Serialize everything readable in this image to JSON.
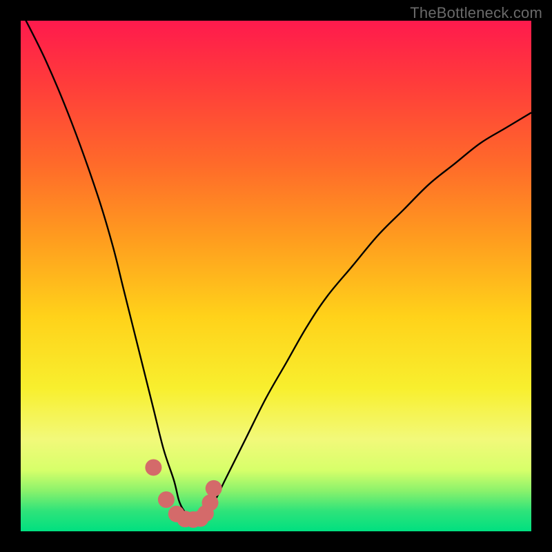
{
  "watermark": {
    "text": "TheBottleneck.com"
  },
  "chart_data": {
    "type": "line",
    "title": "",
    "xlabel": "",
    "ylabel": "",
    "xlim": [
      0,
      100
    ],
    "ylim": [
      0,
      100
    ],
    "grid": false,
    "legend": false,
    "series": [
      {
        "name": "bottleneck-curve",
        "x": [
          0,
          5,
          10,
          15,
          18,
          20,
          22,
          24,
          26,
          28,
          30,
          31,
          32,
          33,
          34,
          35,
          36,
          38,
          40,
          44,
          48,
          52,
          56,
          60,
          65,
          70,
          75,
          80,
          85,
          90,
          95,
          100
        ],
        "values": [
          102,
          92,
          80,
          66,
          56,
          48,
          40,
          32,
          24,
          16,
          10,
          6,
          4,
          3,
          3,
          3,
          4,
          6,
          10,
          18,
          26,
          33,
          40,
          46,
          52,
          58,
          63,
          68,
          72,
          76,
          79,
          82
        ]
      },
      {
        "name": "highlight-dots",
        "x": [
          26,
          28.5,
          30.5,
          32.2,
          33.8,
          35.2,
          36.2,
          37.1,
          37.8
        ],
        "values": [
          12.5,
          6.2,
          3.4,
          2.4,
          2.3,
          2.5,
          3.5,
          5.6,
          8.4
        ]
      }
    ],
    "colors": {
      "curve": "#000000",
      "dots": "#d46a6a"
    }
  }
}
